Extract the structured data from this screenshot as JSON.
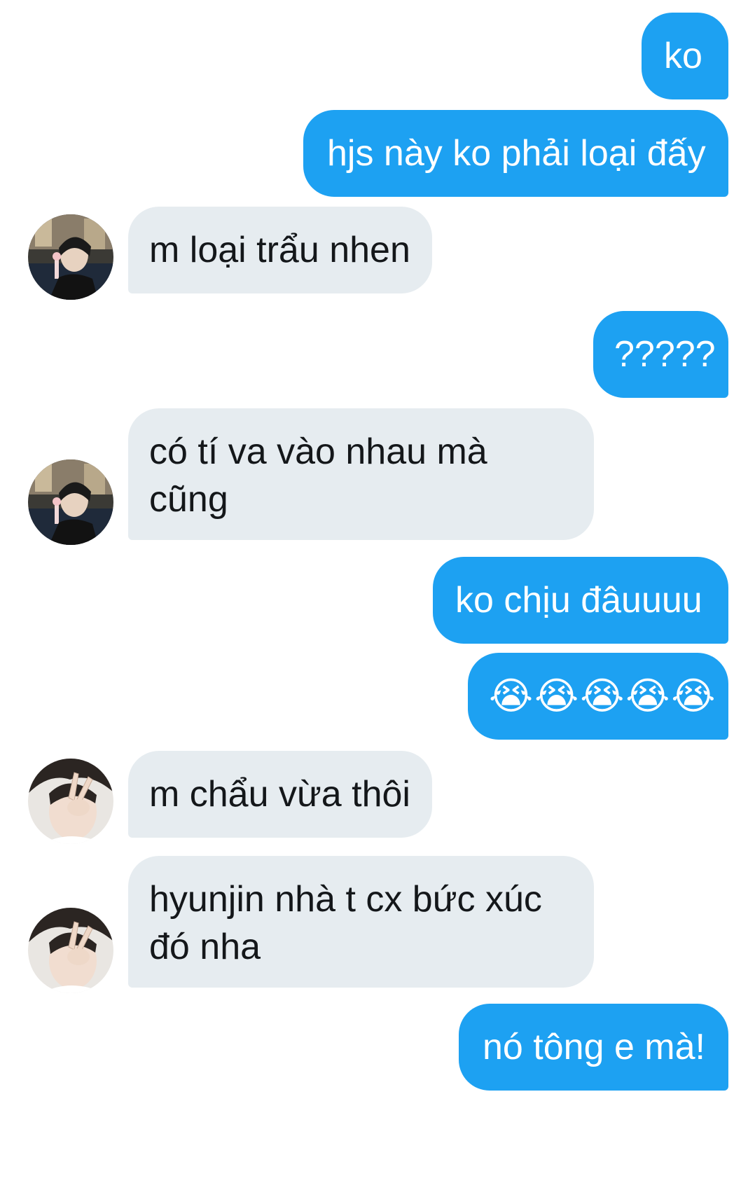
{
  "conversation": {
    "messages": [
      {
        "side": "sent",
        "text": "ko"
      },
      {
        "side": "sent",
        "text": "hjs này ko phải loại đấy"
      },
      {
        "side": "received",
        "text": "m loại trẩu nhen",
        "avatar": "avatar-user-a"
      },
      {
        "side": "sent",
        "text": "?????"
      },
      {
        "side": "received",
        "text": "có tí va vào nhau mà cũng",
        "avatar": "avatar-user-a"
      },
      {
        "side": "sent",
        "text": "ko chịu đâuuuu"
      },
      {
        "side": "sent",
        "text": "😭😭😭😭😭"
      },
      {
        "side": "received",
        "text": "m chẩu vừa thôi",
        "avatar": "avatar-user-b"
      },
      {
        "side": "received",
        "text": "hyunjin nhà t cx bức xúc đó nha",
        "avatar": "avatar-user-b"
      },
      {
        "side": "sent",
        "text": "nó tông e mà!"
      }
    ]
  },
  "colors": {
    "sent_bubble": "#1da1f2",
    "received_bubble": "#e6ecf0",
    "sent_text": "#ffffff",
    "received_text": "#14171a",
    "background": "#ffffff"
  }
}
